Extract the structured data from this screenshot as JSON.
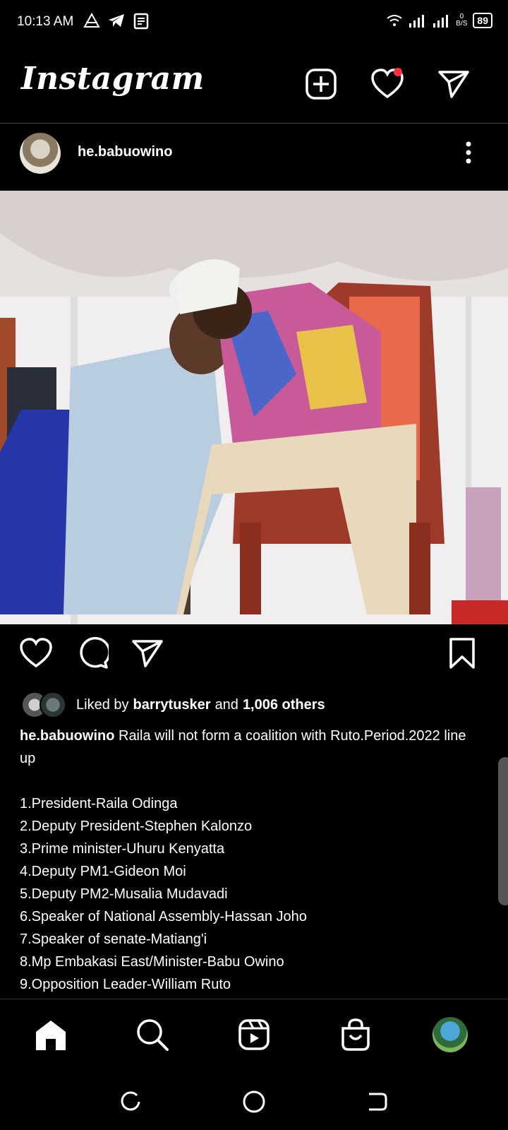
{
  "status_bar": {
    "time": "10:13 AM",
    "speed_value": "0",
    "speed_unit": "B/S",
    "battery": "89",
    "icons_left": [
      "alert-triangle-icon",
      "telegram-icon",
      "news-icon"
    ],
    "icons_right": [
      "wifi-icon",
      "signal-icon",
      "signal-icon"
    ]
  },
  "header": {
    "logo": "Instagram",
    "accent_dot_color": "#ff3040"
  },
  "post": {
    "username": "he.babuowino",
    "likes": {
      "prefix": "Liked by",
      "user": "barrytusker",
      "middle": "and",
      "count": "1,006 others"
    },
    "caption_user": "he.babuowino",
    "caption_text": " Raila will not form a coalition with Ruto.Period.2022 line up",
    "list": [
      "1.President-Raila Odinga",
      "2.Deputy President-Stephen Kalonzo",
      "3.Prime minister-Uhuru Kenyatta",
      "4.Deputy PM1-Gideon Moi",
      "5.Deputy PM2-Musalia Mudavadi",
      "6.Speaker of National Assembly-Hassan Joho",
      "7.Speaker of senate-Matiang'i",
      "8.Mp Embakasi East/Minister-Babu Owino",
      "9.Opposition Leader-William Ruto"
    ]
  },
  "bottom_nav": [
    "home-icon",
    "search-icon",
    "reels-icon",
    "shop-icon",
    "profile-avatar"
  ],
  "system_nav": [
    "recent-apps-icon",
    "home-circle-icon",
    "back-icon"
  ]
}
